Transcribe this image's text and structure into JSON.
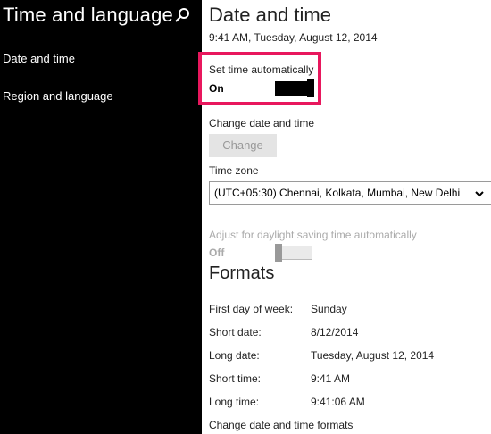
{
  "sidebar": {
    "title": "Time and language",
    "items": [
      {
        "label": "Date and time"
      },
      {
        "label": "Region and language"
      }
    ]
  },
  "main": {
    "title": "Date and time",
    "current_datetime": "9:41 AM, Tuesday, August 12, 2014",
    "set_time_auto": {
      "label": "Set time automatically",
      "state": "On"
    },
    "change_datetime": {
      "label": "Change date and time",
      "button": "Change"
    },
    "time_zone": {
      "label": "Time zone",
      "value": "(UTC+05:30) Chennai, Kolkata, Mumbai, New Delhi"
    },
    "dst": {
      "label": "Adjust for daylight saving time automatically",
      "state": "Off"
    },
    "formats": {
      "title": "Formats",
      "rows": [
        {
          "label": "First day of week:",
          "value": "Sunday"
        },
        {
          "label": "Short date:",
          "value": "8/12/2014"
        },
        {
          "label": "Long date:",
          "value": "Tuesday, August 12, 2014"
        },
        {
          "label": "Short time:",
          "value": "9:41 AM"
        },
        {
          "label": "Long time:",
          "value": "9:41:06 AM"
        }
      ],
      "link": "Change date and time formats"
    }
  },
  "colors": {
    "sidebar_bg": "#000000",
    "highlight": "#e8175d"
  }
}
